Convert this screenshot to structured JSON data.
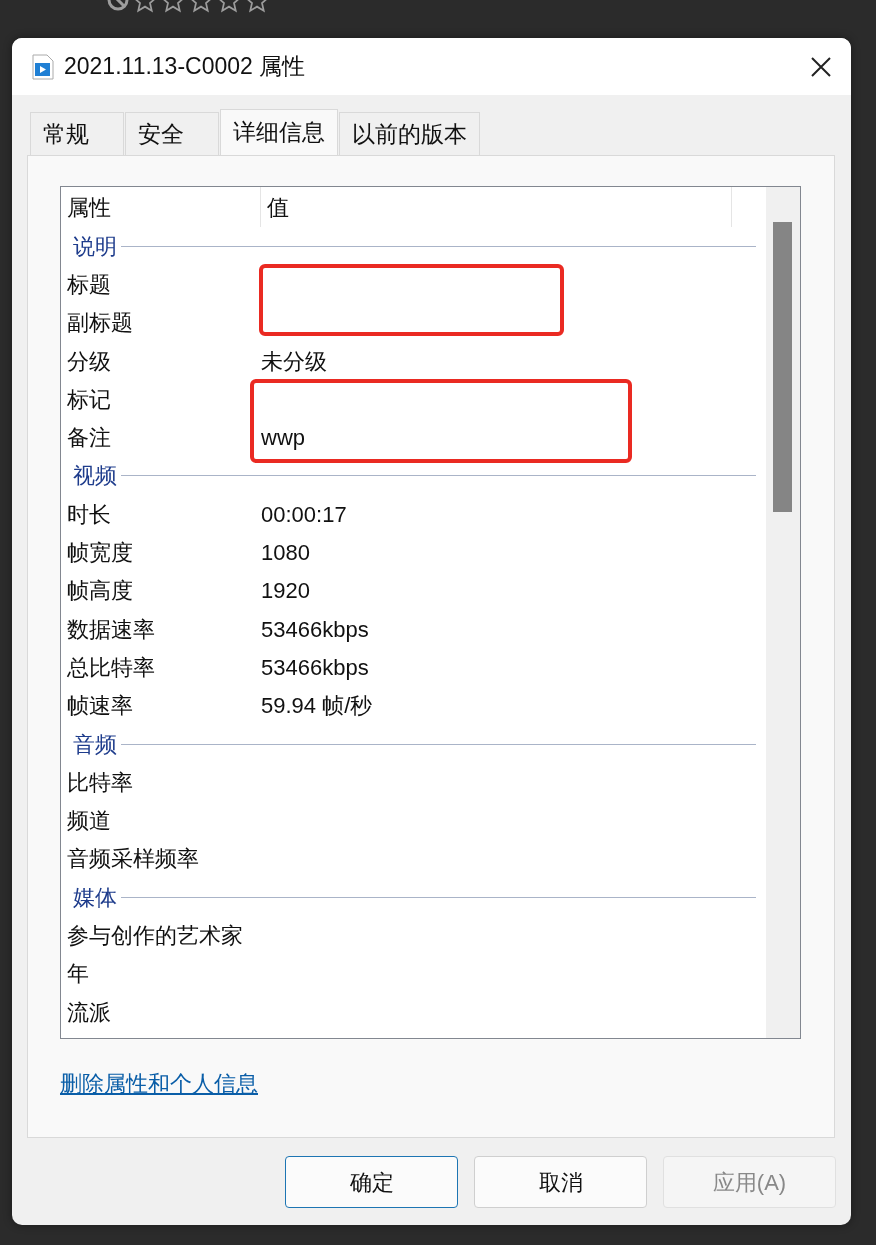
{
  "window": {
    "title": "2021.11.13-C0002 属性"
  },
  "tabs": [
    {
      "label": "常规",
      "selected": false
    },
    {
      "label": "安全",
      "selected": false
    },
    {
      "label": "详细信息",
      "selected": true
    },
    {
      "label": "以前的版本",
      "selected": false
    }
  ],
  "table": {
    "columns": [
      "属性",
      "值"
    ],
    "groups": [
      {
        "heading": "说明",
        "rows": [
          {
            "property": "标题"
          },
          {
            "property": "副标题"
          },
          {
            "property": "分级",
            "value": "未分级"
          },
          {
            "property": "标记"
          },
          {
            "property": "备注",
            "value": "wwp"
          }
        ]
      },
      {
        "heading": "视频",
        "rows": [
          {
            "property": "时长",
            "value": "00:00:17"
          },
          {
            "property": "帧宽度",
            "value": "1080"
          },
          {
            "property": "帧高度",
            "value": "1920"
          },
          {
            "property": "数据速率",
            "value": "53466kbps"
          },
          {
            "property": "总比特率",
            "value": "53466kbps"
          },
          {
            "property": "帧速率",
            "value": "59.94 帧/秒"
          }
        ]
      },
      {
        "heading": "音频",
        "rows": [
          {
            "property": "比特率"
          },
          {
            "property": "频道"
          },
          {
            "property": "音频采样频率"
          }
        ]
      },
      {
        "heading": "媒体",
        "rows": [
          {
            "property": "参与创作的艺术家"
          },
          {
            "property": "年"
          },
          {
            "property": "流派"
          }
        ]
      }
    ]
  },
  "link": "删除属性和个人信息",
  "buttons": [
    {
      "label": "确定",
      "default": true,
      "disabled": false
    },
    {
      "label": "取消",
      "default": false,
      "disabled": false
    },
    {
      "label": "应用(A)",
      "default": false,
      "disabled": true
    }
  ]
}
